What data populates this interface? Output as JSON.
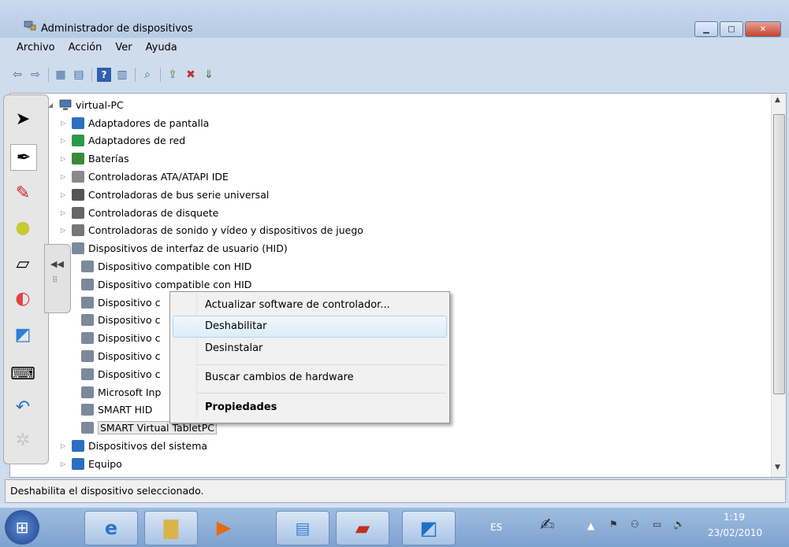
{
  "window": {
    "title": "Administrador de dispositivos"
  },
  "menubar": {
    "items": [
      "Archivo",
      "Acción",
      "Ver",
      "Ayuda"
    ]
  },
  "toolbar": {
    "icons": [
      "back-arrow-icon",
      "forward-arrow-icon",
      "show-hide-console-tree-icon",
      "properties-icon",
      "help-icon",
      "show-hide-action-pane-icon",
      "scan-hardware-icon",
      "update-driver-icon",
      "disable-device-icon",
      "uninstall-device-icon"
    ]
  },
  "tree": {
    "root": "virtual-PC",
    "items": [
      {
        "label": "Adaptadores de pantalla",
        "icon": "display-adapter-icon",
        "level": 1
      },
      {
        "label": "Adaptadores de red",
        "icon": "network-adapter-icon",
        "level": 1
      },
      {
        "label": "Baterías",
        "icon": "battery-icon",
        "level": 1
      },
      {
        "label": "Controladoras ATA/ATAPI IDE",
        "icon": "ide-controller-icon",
        "level": 1
      },
      {
        "label": "Controladoras de bus serie universal",
        "icon": "usb-icon",
        "level": 1
      },
      {
        "label": "Controladoras de disquete",
        "icon": "floppy-controller-icon",
        "level": 1
      },
      {
        "label": "Controladoras de sonido y vídeo y dispositivos de juego",
        "icon": "speaker-icon",
        "level": 1
      },
      {
        "label": "Dispositivos de interfaz de usuario (HID)",
        "icon": "hid-icon",
        "level": 1,
        "expanded": true
      },
      {
        "label": "Dispositivo compatible con HID",
        "icon": "hid-icon",
        "level": 2
      },
      {
        "label": "Dispositivo compatible con HID",
        "icon": "hid-icon",
        "level": 2
      },
      {
        "label": "Dispositivo c",
        "icon": "hid-icon",
        "level": 2
      },
      {
        "label": "Dispositivo c",
        "icon": "hid-icon",
        "level": 2
      },
      {
        "label": "Dispositivo c",
        "icon": "hid-icon",
        "level": 2
      },
      {
        "label": "Dispositivo c",
        "icon": "hid-icon",
        "level": 2
      },
      {
        "label": "Dispositivo c",
        "icon": "hid-icon",
        "level": 2
      },
      {
        "label": "Microsoft Inp",
        "icon": "hid-icon",
        "level": 2
      },
      {
        "label": "SMART HID",
        "icon": "hid-icon",
        "level": 2
      },
      {
        "label": "SMART Virtual TabletPC",
        "icon": "hid-icon",
        "level": 2,
        "selected": true
      },
      {
        "label": "Dispositivos del sistema",
        "icon": "system-device-icon",
        "level": 1
      },
      {
        "label": "Equipo",
        "icon": "computer-icon",
        "level": 1
      }
    ]
  },
  "context_menu": {
    "items": [
      "Actualizar software de controlador...",
      "Deshabilitar",
      "Desinstalar",
      "Buscar cambios de hardware",
      "Propiedades"
    ],
    "highlighted": "Deshabilitar"
  },
  "status": {
    "text": "Deshabilita el dispositivo seleccionado."
  },
  "taskbar": {
    "language": "ES",
    "time": "1:19",
    "date": "23/02/2010"
  },
  "colors": {
    "selection": "#cce8ff",
    "menu_highlight": "#dcedf8",
    "taskbar": "#8bb0da"
  }
}
